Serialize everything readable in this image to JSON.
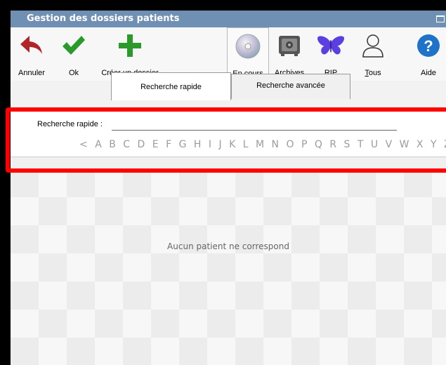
{
  "window": {
    "title": "Gestion des dossiers patients"
  },
  "toolbar": {
    "cancel": {
      "label": "Annuler",
      "icon": "undo-arrow-icon",
      "color": "#b0242a"
    },
    "ok": {
      "label": "Ok",
      "icon": "checkmark-icon",
      "color": "#2a9a2a"
    },
    "create": {
      "label": "Créer un dossier",
      "icon": "plus-icon",
      "color": "#2a9a2a"
    },
    "current": {
      "label_ul": "E",
      "label_rest": "n cours",
      "icon": "cd-disc-icon"
    },
    "archives": {
      "label_ul": "A",
      "label_rest": "rchives",
      "icon": "safe-icon"
    },
    "rip": {
      "label": "RIP",
      "icon": "butterfly-icon",
      "color": "#5b3fe0"
    },
    "all": {
      "label_ul": "T",
      "label_rest": "ous",
      "icon": "person-outline-icon"
    },
    "help": {
      "label": "Aide",
      "icon": "help-icon",
      "color": "#1e73c8"
    }
  },
  "tabs": [
    {
      "label": "Recherche rapide",
      "active": true
    },
    {
      "label": "Recherche avancée",
      "active": false
    }
  ],
  "search": {
    "label": "Recherche rapide :",
    "value": "",
    "letters": [
      "<",
      "A",
      "B",
      "C",
      "D",
      "E",
      "F",
      "G",
      "H",
      "I",
      "J",
      "K",
      "L",
      "M",
      "N",
      "O",
      "P",
      "Q",
      "R",
      "S",
      "T",
      "U",
      "V",
      "W",
      "X",
      "Y",
      "Z",
      "'",
      "-",
      "_"
    ]
  },
  "results": {
    "empty_message": "Aucun patient ne correspond"
  },
  "colors": {
    "titlebar": "#6f8fb3",
    "highlight_box": "#ff0000"
  }
}
